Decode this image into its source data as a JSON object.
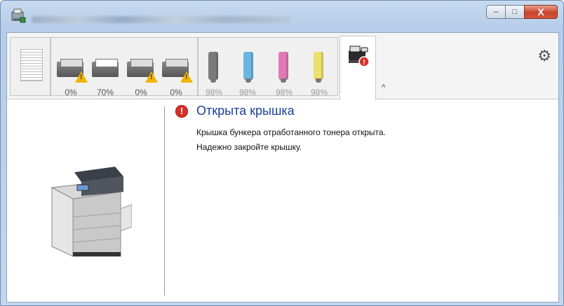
{
  "window": {
    "title": "",
    "controls": {
      "minimize": "–",
      "maximize": "□",
      "close": "X"
    }
  },
  "toolbar": {
    "trays": [
      {
        "name": "tray-1",
        "level": "0%",
        "warning": true
      },
      {
        "name": "tray-2",
        "level": "70%",
        "warning": false
      },
      {
        "name": "tray-3",
        "level": "0%",
        "warning": true
      },
      {
        "name": "tray-4",
        "level": "0%",
        "warning": true
      }
    ],
    "toners": [
      {
        "name": "black",
        "level": "98%",
        "color": "#7b7b7b"
      },
      {
        "name": "cyan",
        "level": "98%",
        "color": "#69b6e3"
      },
      {
        "name": "magenta",
        "level": "98%",
        "color": "#e07ab6"
      },
      {
        "name": "yellow",
        "level": "98%",
        "color": "#ece16a"
      }
    ],
    "collapse_label": "^"
  },
  "status": {
    "title": "Открыта крышка",
    "lines": [
      "Крышка бункера отработанного тонера открыта.",
      "Надежно закройте крышку."
    ],
    "error_badge": "!"
  },
  "colors": {
    "accent": "#1b3f9a",
    "error": "#d9302a",
    "warning": "#f0b400"
  }
}
